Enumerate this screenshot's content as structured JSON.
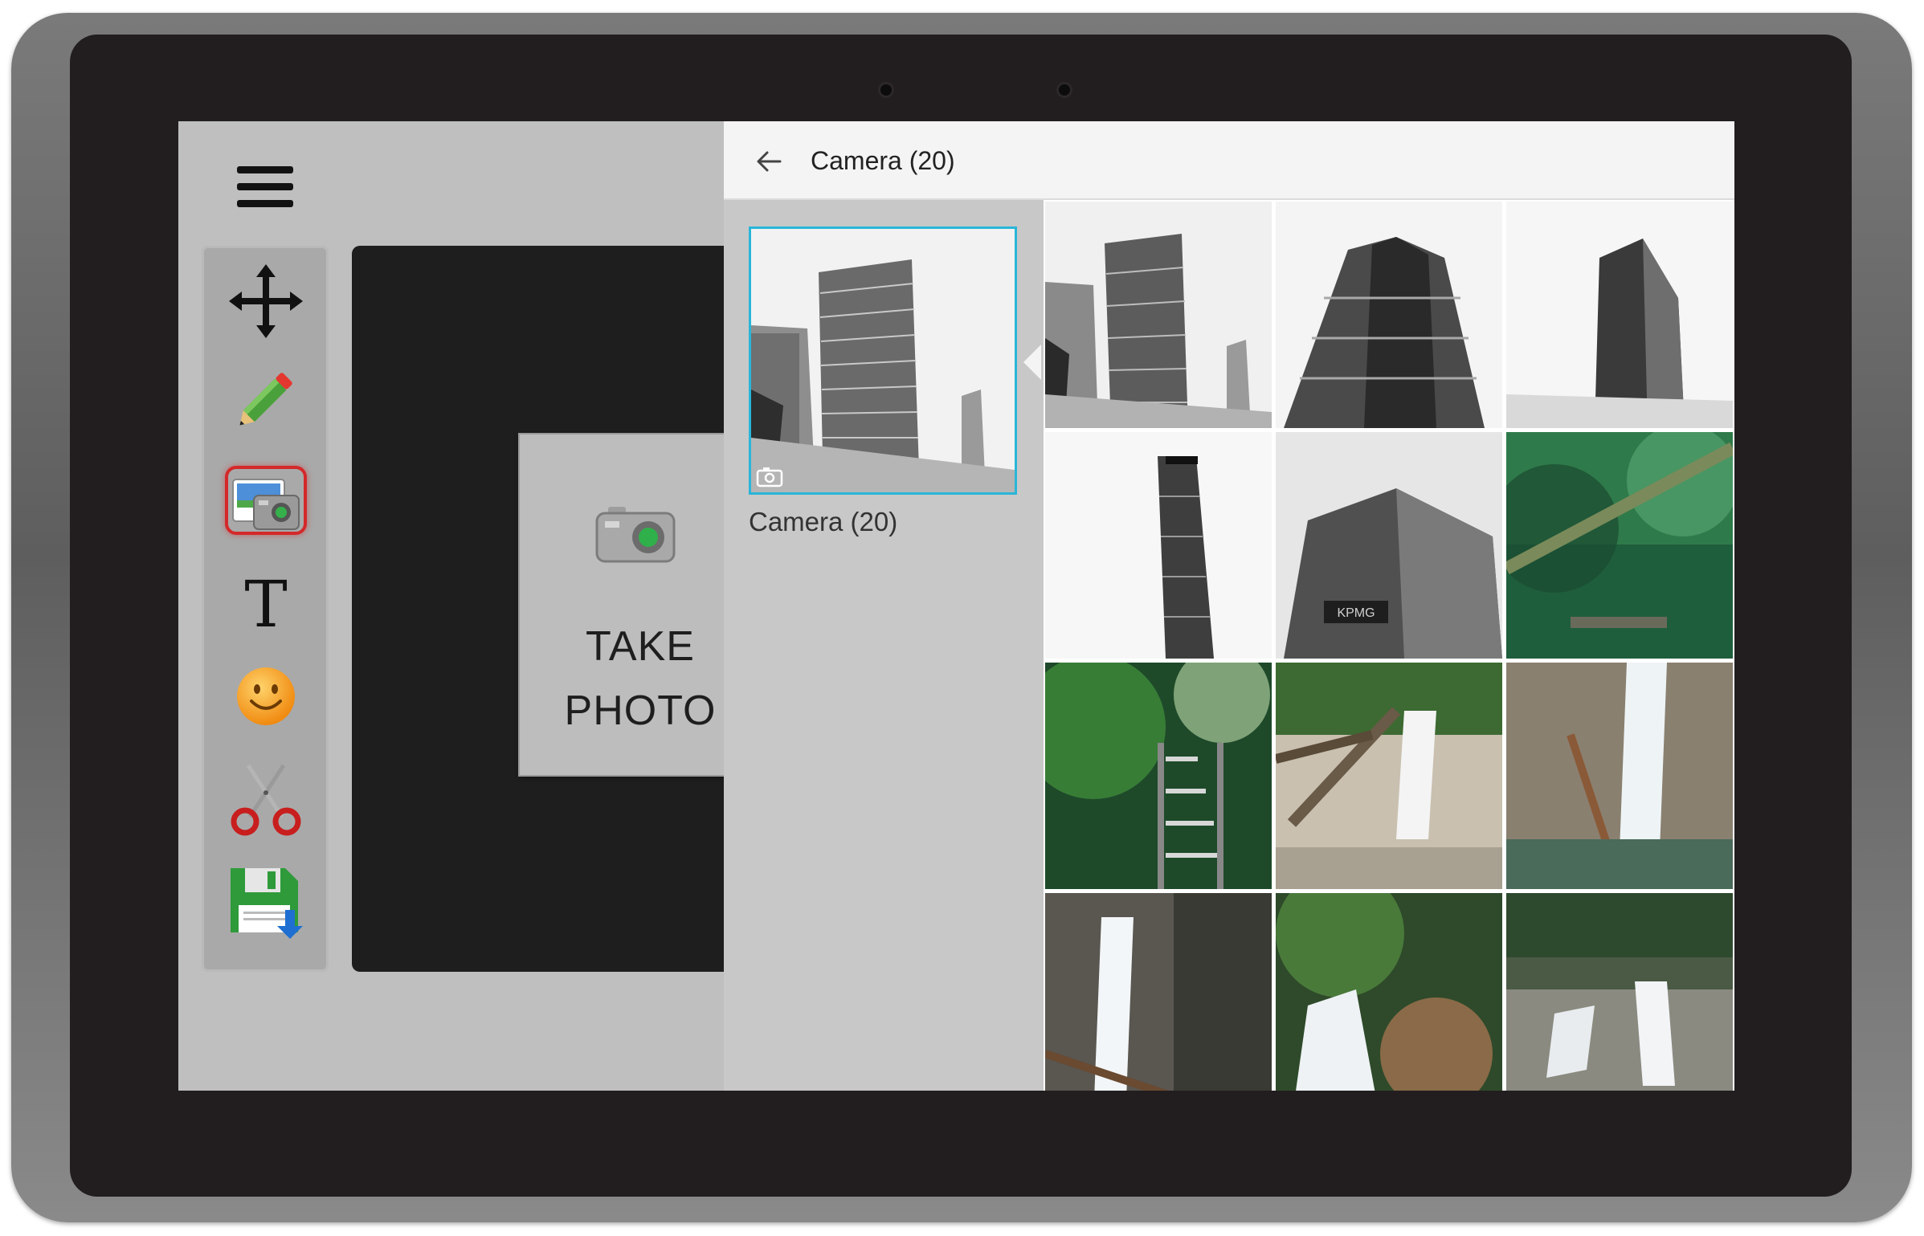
{
  "editor": {
    "menu_icon": "hamburger-menu-icon",
    "tools": [
      {
        "id": "move",
        "icon": "move-arrows-icon"
      },
      {
        "id": "draw",
        "icon": "pencil-icon"
      },
      {
        "id": "photo",
        "icon": "photo-picker-icon",
        "selected": true
      },
      {
        "id": "text",
        "icon": "text-t-icon",
        "glyph": "T"
      },
      {
        "id": "sticker",
        "icon": "smiley-icon"
      },
      {
        "id": "crop",
        "icon": "scissors-icon"
      },
      {
        "id": "save",
        "icon": "save-floppy-icon"
      }
    ],
    "take_photo_label": "TAKE PHOTO"
  },
  "gallery": {
    "title": "Camera (20)",
    "back_icon": "back-arrow-icon",
    "album": {
      "label": "Camera  (20)",
      "badge_icon": "camera-icon"
    },
    "thumbnails": [
      {
        "subject": "office tower"
      },
      {
        "subject": "curved skyscraper"
      },
      {
        "subject": "glass tower"
      },
      {
        "subject": "tall tower"
      },
      {
        "subject": "KPMG building",
        "text": "KPMG"
      },
      {
        "subject": "fallen tree in forest"
      },
      {
        "subject": "forest ladder"
      },
      {
        "subject": "stream with logs"
      },
      {
        "subject": "waterfall"
      },
      {
        "subject": "waterfall rocks"
      },
      {
        "subject": "mountain stream"
      },
      {
        "subject": "rocky cascade"
      }
    ]
  },
  "colors": {
    "accent_selected": "#29b6d8",
    "tool_selected_ring": "#d4282a",
    "bezel": "#221e1f"
  }
}
